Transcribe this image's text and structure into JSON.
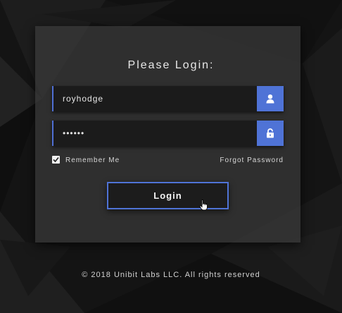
{
  "colors": {
    "background": "#141414",
    "panel": "#3a3a3a",
    "accent": "#4f73d6",
    "text": "#e8e8e8"
  },
  "login": {
    "title": "Please Login:",
    "username": {
      "value": "royhodge",
      "icon": "user-icon"
    },
    "password": {
      "value": "••••••",
      "icon": "unlock-icon"
    },
    "remember_me": {
      "label": "Remember Me",
      "checked": true
    },
    "forgot_password": "Forgot Password",
    "submit_label": "Login"
  },
  "footer": {
    "copyright": "© 2018 Unibit Labs LLC. All rights reserved"
  }
}
